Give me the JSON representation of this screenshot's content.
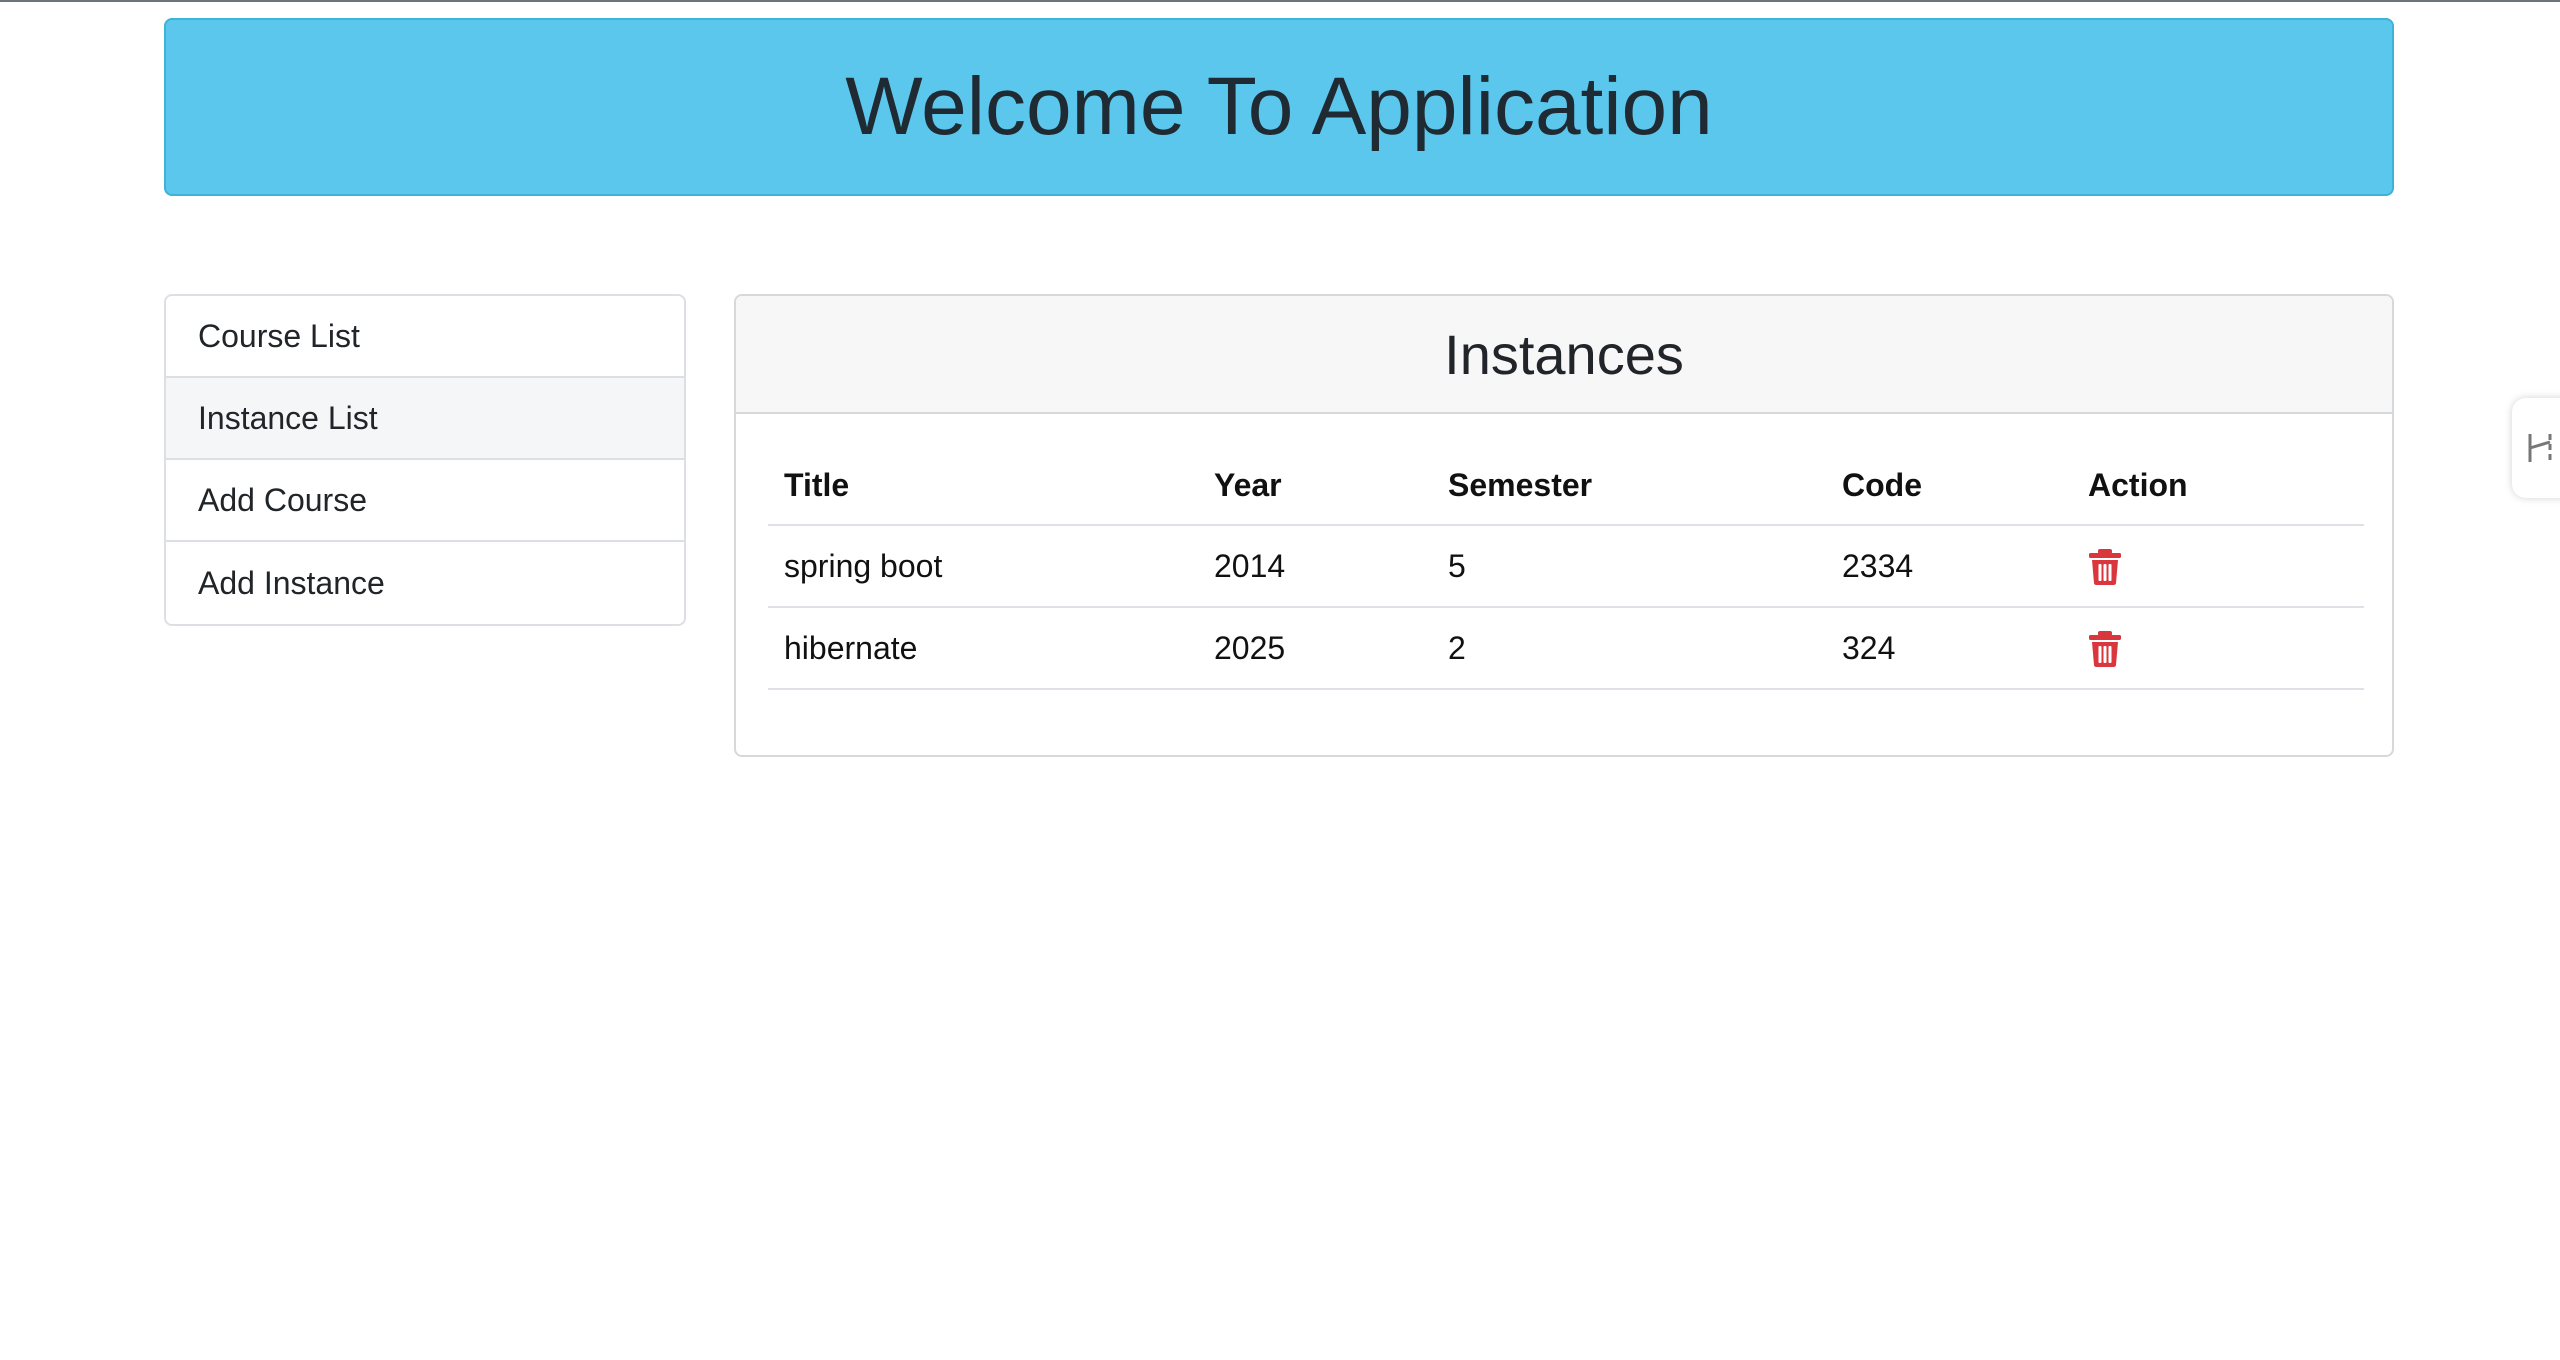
{
  "header": {
    "title": "Welcome To Application"
  },
  "sidebar": {
    "items": [
      {
        "label": "Course List"
      },
      {
        "label": "Instance List"
      },
      {
        "label": "Add Course"
      },
      {
        "label": "Add Instance"
      }
    ]
  },
  "panel": {
    "title": "Instances",
    "columns": [
      "Title",
      "Year",
      "Semester",
      "Code",
      "Action"
    ],
    "rows": [
      {
        "title": "spring boot",
        "year": "2014",
        "semester": "5",
        "code": "2334",
        "action_icon": "trash-icon"
      },
      {
        "title": "hibernate",
        "year": "2025",
        "semester": "2",
        "code": "324",
        "action_icon": "trash-icon"
      }
    ]
  },
  "colors": {
    "banner": "#5bc7ed",
    "delete": "#d9363e",
    "active_item": "#f5f6f8"
  },
  "side_handle": {
    "icon": "extension-handle-icon"
  }
}
